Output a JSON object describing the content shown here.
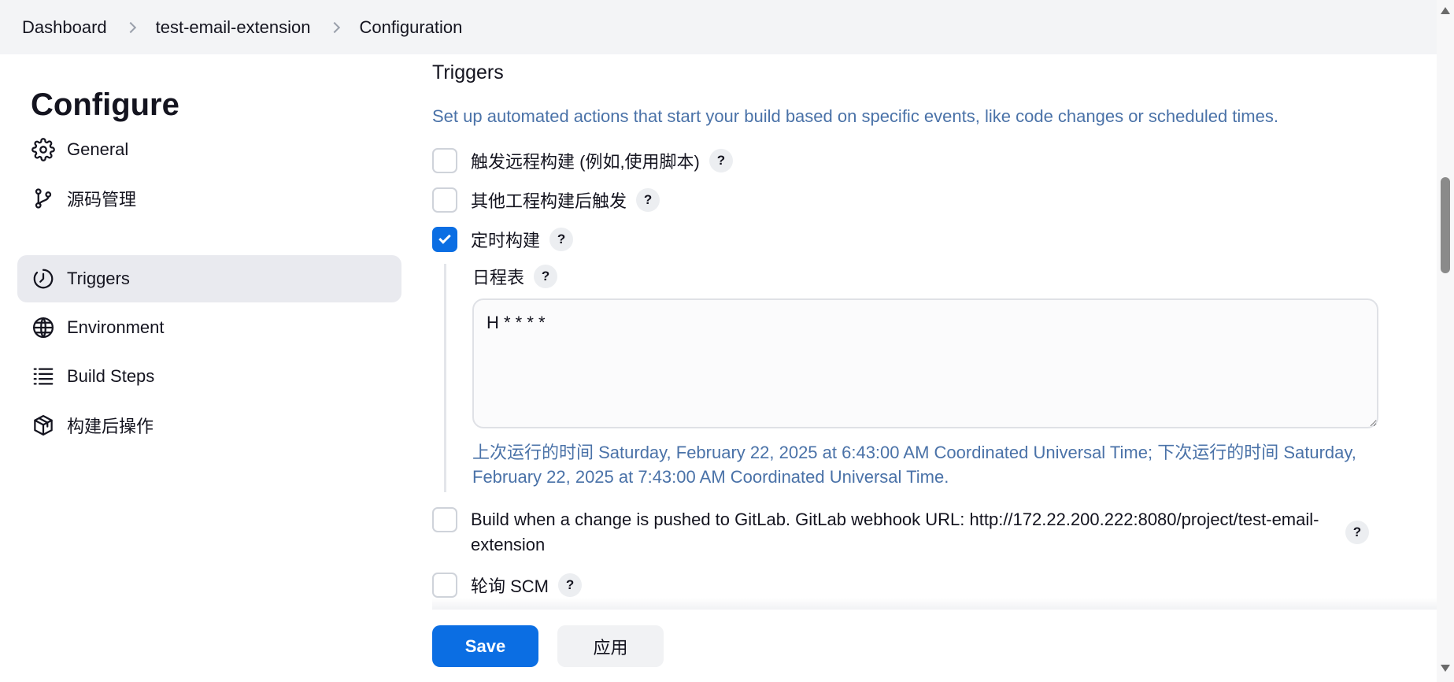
{
  "breadcrumb": {
    "items": [
      "Dashboard",
      "test-email-extension",
      "Configuration"
    ]
  },
  "sidebar": {
    "title": "Configure",
    "items": [
      {
        "label": "General",
        "icon": "gear-icon",
        "active": false
      },
      {
        "label": "源码管理",
        "icon": "branch-icon",
        "active": false
      },
      {
        "label": "Triggers",
        "icon": "clock-icon",
        "active": true
      },
      {
        "label": "Environment",
        "icon": "globe-icon",
        "active": false
      },
      {
        "label": "Build Steps",
        "icon": "list-icon",
        "active": false
      },
      {
        "label": "构建后操作",
        "icon": "package-icon",
        "active": false
      }
    ]
  },
  "triggers": {
    "title": "Triggers",
    "description": "Set up automated actions that start your build based on specific events, like code changes or scheduled times.",
    "options": [
      {
        "label": "触发远程构建 (例如,使用脚本)",
        "checked": false
      },
      {
        "label": "其他工程构建后触发",
        "checked": false
      },
      {
        "label": "定时构建",
        "checked": true
      }
    ],
    "schedule": {
      "label": "日程表",
      "value": "H * * * *",
      "run_info": "上次运行的时间 Saturday, February 22, 2025 at 6:43:00 AM Coordinated Universal Time; 下次运行的时间 Saturday, February 22, 2025 at 7:43:00 AM Coordinated Universal Time."
    },
    "gitlab": {
      "label": "Build when a change is pushed to GitLab. GitLab webhook URL: http://172.22.200.222:8080/project/test-email-extension",
      "checked": false
    },
    "poll_scm": {
      "label": "轮询 SCM",
      "checked": false
    },
    "help_label": "?"
  },
  "actions": {
    "save_label": "Save",
    "apply_label": "应用"
  },
  "colors": {
    "accent": "#0b6ee3",
    "link_text": "#4a72a8",
    "active_nav": "#e9eaef"
  }
}
